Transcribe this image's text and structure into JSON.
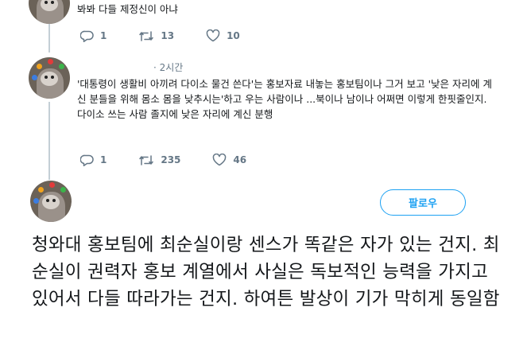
{
  "tweets": [
    {
      "text": "봐봐 다들 제정신이 아냐",
      "actions": {
        "reply_count": "1",
        "retweet_count": "13",
        "like_count": "10"
      }
    },
    {
      "timestamp": "· 2시간",
      "text": "'대통령이 생활비 아끼려 다이소 물건 쓴다'는 홍보자료 내놓는 홍보팀이나 그거 보고 '낮은 자리에 계신 분들을 위해 몸소 몸을 낮추시는'하고 우는 사람이나 ...북이나 남이나 어쩌면 이렇게 한핏줄인지. 다이소 쓰는 사람 졸지에 낮은 자리에 계신 분행",
      "actions": {
        "reply_count": "1",
        "retweet_count": "235",
        "like_count": "46"
      }
    }
  ],
  "main_tweet": {
    "follow_label": "팔로우",
    "text": "청와대 홍보팀에 최순실이랑 센스가 똑같은 자가 있는 건지. 최순실이 권력자 홍보 계열에서 사실은 독보적인 능력을 가지고 있어서 다들 따라가는 건지. 하여튼 발상이 기가 막히게 동일함"
  },
  "icons": {
    "reply": "reply-icon",
    "retweet": "retweet-icon",
    "like": "heart-icon"
  },
  "colors": {
    "accent": "#1da1f2",
    "muted": "#657786",
    "thread_line": "#c4cfd6",
    "text": "#14171a"
  }
}
